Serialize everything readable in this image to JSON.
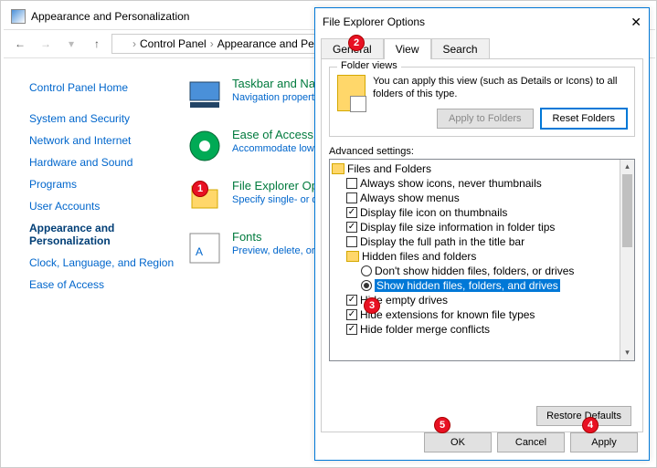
{
  "cp": {
    "title": "Appearance and Personalization",
    "breadcrumb": [
      "Control Panel",
      "Appearance and Personalization"
    ],
    "side": {
      "home": "Control Panel Home",
      "links": [
        "System and Security",
        "Network and Internet",
        "Hardware and Sound",
        "Programs",
        "User Accounts",
        "Appearance and Personalization",
        "Clock, Language, and Region",
        "Ease of Access"
      ]
    },
    "cats": [
      {
        "title": "Taskbar and Navigation",
        "sub": "Navigation properties"
      },
      {
        "title": "Ease of Access Center",
        "sub": "Accommodate low vision | Turn High Contrast on or off"
      },
      {
        "title": "File Explorer Options",
        "sub": "Specify single- or double-click to open"
      },
      {
        "title": "Fonts",
        "sub": "Preview, delete, or show and hide fonts"
      }
    ]
  },
  "dlg": {
    "title": "File Explorer Options",
    "tabs": [
      "General",
      "View",
      "Search"
    ],
    "folder_views": {
      "legend": "Folder views",
      "text": "You can apply this view (such as Details or Icons) to all folders of this type.",
      "apply": "Apply to Folders",
      "reset": "Reset Folders"
    },
    "adv_label": "Advanced settings:",
    "tree": {
      "root": "Files and Folders",
      "items": [
        {
          "t": "chk",
          "c": false,
          "l": "Always show icons, never thumbnails"
        },
        {
          "t": "chk",
          "c": false,
          "l": "Always show menus"
        },
        {
          "t": "chk",
          "c": true,
          "l": "Display file icon on thumbnails"
        },
        {
          "t": "chk",
          "c": true,
          "l": "Display file size information in folder tips"
        },
        {
          "t": "chk",
          "c": false,
          "l": "Display the full path in the title bar"
        },
        {
          "t": "folder",
          "l": "Hidden files and folders"
        },
        {
          "t": "rad",
          "c": false,
          "l": "Don't show hidden files, folders, or drives"
        },
        {
          "t": "rad",
          "c": true,
          "l": "Show hidden files, folders, and drives",
          "hl": true
        },
        {
          "t": "chk",
          "c": true,
          "l": "Hide empty drives"
        },
        {
          "t": "chk",
          "c": true,
          "l": "Hide extensions for known file types"
        },
        {
          "t": "chk",
          "c": true,
          "l": "Hide folder merge conflicts"
        }
      ]
    },
    "restore": "Restore Defaults",
    "ok": "OK",
    "cancel": "Cancel",
    "apply": "Apply"
  },
  "badges": [
    "1",
    "2",
    "3",
    "4",
    "5"
  ]
}
